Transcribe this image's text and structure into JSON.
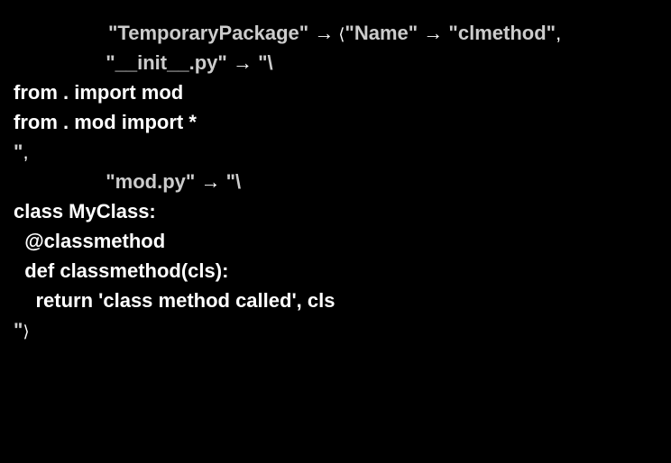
{
  "line1": {
    "str1": "\"TemporaryPackage\"",
    "arrow1": "→",
    "str2": "\"Name\"",
    "arrow2": "→",
    "str3": "\"clmethod\""
  },
  "line2": {
    "str": "\"__init__.py\"",
    "arrow": "→",
    "backslash": "\"\\"
  },
  "line3": "from . import mod",
  "line4": "from . mod import *",
  "line5_str": "\"",
  "line6": {
    "str": "\"mod.py\"",
    "arrow": "→",
    "backslash": "\"\\"
  },
  "line7": "class MyClass:",
  "line8": "  @classmethod",
  "line9": "  def classmethod(cls):",
  "line10": "    return 'class method called', cls",
  "line11_str": "\""
}
